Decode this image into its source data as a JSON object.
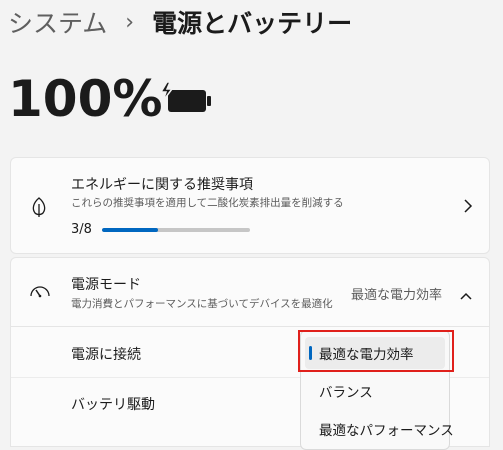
{
  "breadcrumb": {
    "parent": "システム",
    "separator": "›",
    "current": "電源とバッテリー"
  },
  "battery": {
    "percent_text": "100%",
    "icon": "battery-charging-icon"
  },
  "recommendations": {
    "title": "エネルギーに関する推奨事項",
    "subtitle": "これらの推奨事項を適用して二酸化炭素排出量を削減する",
    "progress_text": "3/8",
    "progress_fraction": 0.375,
    "icon": "leaf-icon"
  },
  "power_mode": {
    "title": "電源モード",
    "subtitle": "電力消費とパフォーマンスに基づいてデバイスを最適化",
    "current_value": "最適な電力効率",
    "icon": "gauge-icon",
    "rows": {
      "plugged_in": "電源に接続",
      "on_battery": "バッテリ駆動"
    },
    "dropdown": {
      "options": [
        "最適な電力効率",
        "バランス",
        "最適なパフォーマンス"
      ],
      "selected_index": 0
    }
  },
  "colors": {
    "accent": "#0067c0",
    "highlight": "#e0201b"
  }
}
